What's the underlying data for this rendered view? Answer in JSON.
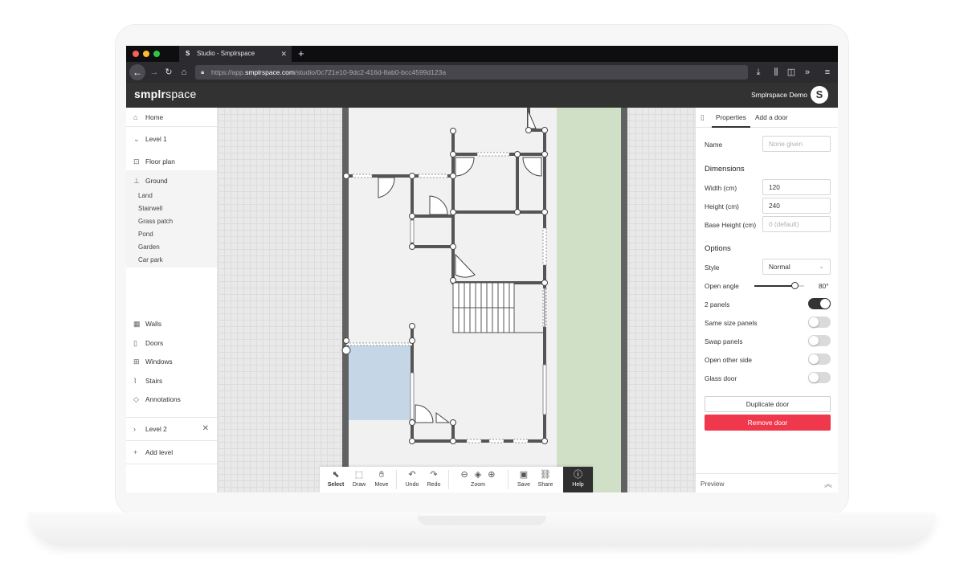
{
  "browser": {
    "tab_title": "Studio - Smplrspace",
    "tab_favicon": "S",
    "url_prefix": "https://app.",
    "url_host": "smplrspace.com",
    "url_path": "/studio/0c721e10-9dc2-416d-8ab0-bcc4599d123a"
  },
  "app": {
    "logo_bold": "smplr",
    "logo_light": "space",
    "user_name": "Smplrspace Demo",
    "avatar_letter": "S"
  },
  "sidebar": {
    "home": "Home",
    "level1": "Level 1",
    "floor_plan": "Floor plan",
    "ground": "Ground",
    "ground_items": [
      "Land",
      "Stairwell",
      "Grass patch",
      "Pond",
      "Garden",
      "Car park"
    ],
    "walls": "Walls",
    "doors": "Doors",
    "windows": "Windows",
    "stairs": "Stairs",
    "annotations": "Annotations",
    "level2": "Level 2",
    "add_level": "Add level"
  },
  "toolbar": {
    "select": "Select",
    "draw": "Draw",
    "move": "Move",
    "undo": "Undo",
    "redo": "Redo",
    "zoom": "Zoom",
    "save": "Save",
    "share": "Share",
    "help": "Help"
  },
  "panel": {
    "tab_properties": "Properties",
    "tab_add_door": "Add a door",
    "name_label": "Name",
    "name_placeholder": "None given",
    "dimensions_heading": "Dimensions",
    "width_label": "Width (cm)",
    "width_value": "120",
    "height_label": "Height (cm)",
    "height_value": "240",
    "base_height_label": "Base Height (cm)",
    "base_height_placeholder": "0 (default)",
    "options_heading": "Options",
    "style_label": "Style",
    "style_value": "Normal",
    "open_angle_label": "Open angle",
    "open_angle_value": "80°",
    "open_angle_level": 0.82,
    "toggles": [
      {
        "label": "2 panels",
        "on": true
      },
      {
        "label": "Same size panels",
        "on": false
      },
      {
        "label": "Swap panels",
        "on": false
      },
      {
        "label": "Open other side",
        "on": false
      },
      {
        "label": "Glass door",
        "on": false
      }
    ],
    "duplicate_label": "Duplicate door",
    "remove_label": "Remove door",
    "preview_label": "Preview"
  },
  "colors": {
    "accent_danger": "#f0384c",
    "app_bar": "#323232",
    "garden_green": "#cfe0c6",
    "pond_blue": "#c5d6e6"
  }
}
